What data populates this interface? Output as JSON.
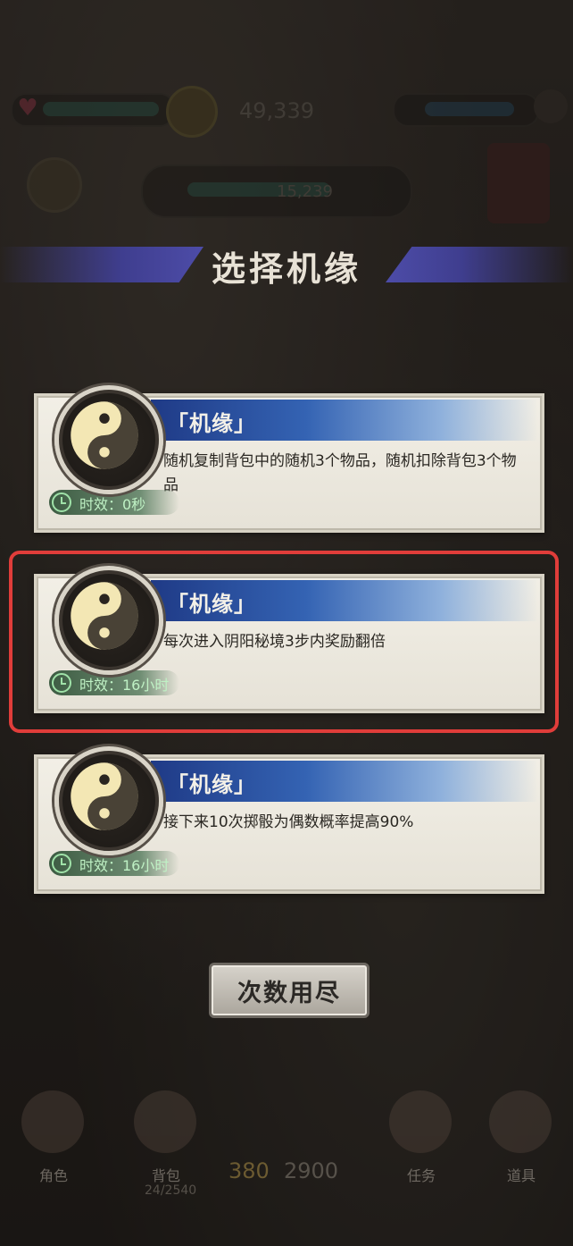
{
  "hud": {
    "coins": "49,339",
    "mid_value": "15,239",
    "score_a": "380",
    "score_b": "2900",
    "bottom_sub": "24/2540"
  },
  "title": "选择机缘",
  "cards": [
    {
      "header": "「机缘」",
      "description": "随机复制背包中的随机3个物品，随机扣除背包3个物品",
      "duration": "时效：0秒"
    },
    {
      "header": "「机缘」",
      "description": "每次进入阴阳秘境3步内奖励翻倍",
      "duration": "时效：16小时"
    },
    {
      "header": "「机缘」",
      "description": "接下来10次掷骰为偶数概率提高90%",
      "duration": "时效：16小时"
    }
  ],
  "button": {
    "label": "次数用尽"
  },
  "bottom_nav": [
    "角色",
    "背包",
    "任务",
    "道具"
  ],
  "colors": {
    "highlight": "#e03d3a",
    "card_header": "#1f3a86",
    "duration_text": "#bff1c4",
    "stripe": "#3f3e8f"
  },
  "icons": [
    "yin-yang-icon",
    "clock-icon",
    "heart-icon",
    "coin-icon"
  ]
}
